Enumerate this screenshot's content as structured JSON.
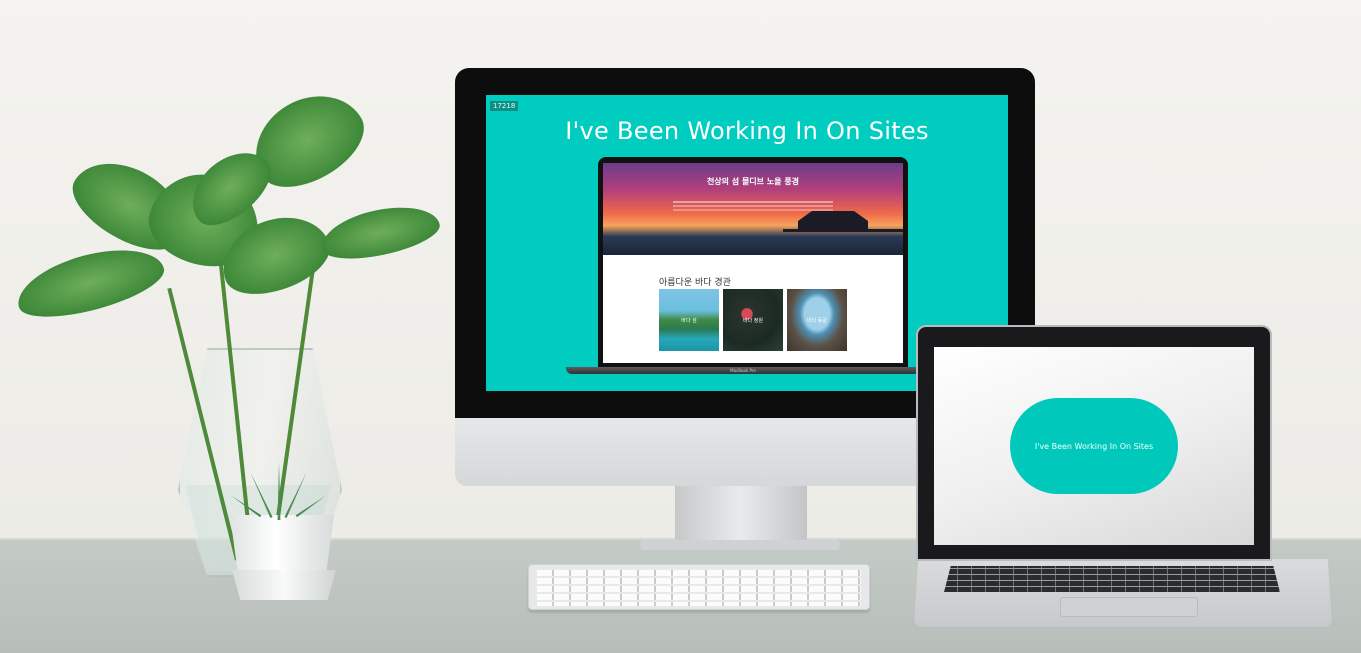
{
  "imac": {
    "badge": "17218",
    "title": "I've Been Working In On Sites",
    "inner_laptop": {
      "hero_title": "천상의 섬 몰디브 노을 풍경",
      "section_title": "아름다운 바다 경관",
      "thumbs": [
        {
          "label": "바다 섬"
        },
        {
          "label": "바다 정원"
        },
        {
          "label": "바다 동굴"
        }
      ],
      "model_label": "MacBook Pro"
    }
  },
  "laptop": {
    "pill_text": "I've Been Working In On Sites"
  },
  "colors": {
    "accent": "#00cdbf",
    "pill": "#00c9bb"
  }
}
